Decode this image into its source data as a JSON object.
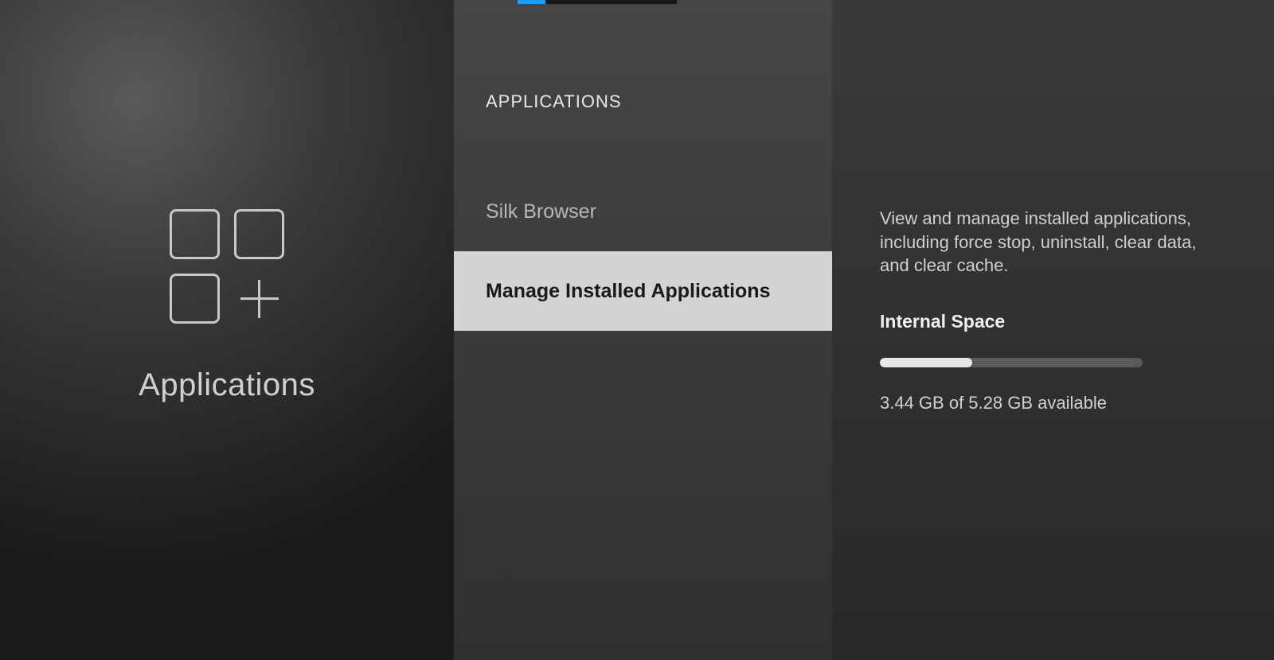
{
  "left_panel": {
    "title": "Applications"
  },
  "middle_panel": {
    "header": "APPLICATIONS",
    "items": [
      {
        "label": "Silk Browser",
        "selected": false
      },
      {
        "label": "Manage Installed Applications",
        "selected": true
      }
    ]
  },
  "right_panel": {
    "description": "View and manage installed applications, including force stop, uninstall, clear data, and clear cache.",
    "storage_heading": "Internal Space",
    "storage_used_percent": 35,
    "storage_text": "3.44 GB of 5.28 GB available"
  }
}
